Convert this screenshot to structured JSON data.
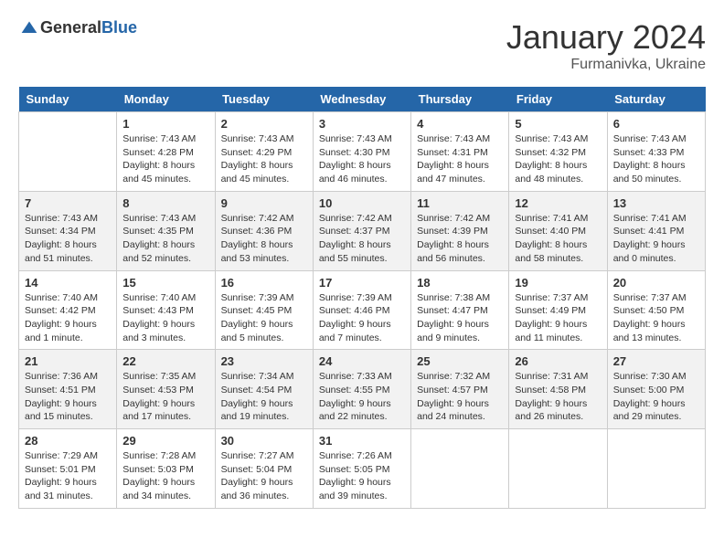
{
  "header": {
    "logo_general": "General",
    "logo_blue": "Blue",
    "month": "January 2024",
    "location": "Furmanivka, Ukraine"
  },
  "weekdays": [
    "Sunday",
    "Monday",
    "Tuesday",
    "Wednesday",
    "Thursday",
    "Friday",
    "Saturday"
  ],
  "weeks": [
    [
      {
        "day": "",
        "sunrise": "",
        "sunset": "",
        "daylight": ""
      },
      {
        "day": "1",
        "sunrise": "Sunrise: 7:43 AM",
        "sunset": "Sunset: 4:28 PM",
        "daylight": "Daylight: 8 hours and 45 minutes."
      },
      {
        "day": "2",
        "sunrise": "Sunrise: 7:43 AM",
        "sunset": "Sunset: 4:29 PM",
        "daylight": "Daylight: 8 hours and 45 minutes."
      },
      {
        "day": "3",
        "sunrise": "Sunrise: 7:43 AM",
        "sunset": "Sunset: 4:30 PM",
        "daylight": "Daylight: 8 hours and 46 minutes."
      },
      {
        "day": "4",
        "sunrise": "Sunrise: 7:43 AM",
        "sunset": "Sunset: 4:31 PM",
        "daylight": "Daylight: 8 hours and 47 minutes."
      },
      {
        "day": "5",
        "sunrise": "Sunrise: 7:43 AM",
        "sunset": "Sunset: 4:32 PM",
        "daylight": "Daylight: 8 hours and 48 minutes."
      },
      {
        "day": "6",
        "sunrise": "Sunrise: 7:43 AM",
        "sunset": "Sunset: 4:33 PM",
        "daylight": "Daylight: 8 hours and 50 minutes."
      }
    ],
    [
      {
        "day": "7",
        "sunrise": "Sunrise: 7:43 AM",
        "sunset": "Sunset: 4:34 PM",
        "daylight": "Daylight: 8 hours and 51 minutes."
      },
      {
        "day": "8",
        "sunrise": "Sunrise: 7:43 AM",
        "sunset": "Sunset: 4:35 PM",
        "daylight": "Daylight: 8 hours and 52 minutes."
      },
      {
        "day": "9",
        "sunrise": "Sunrise: 7:42 AM",
        "sunset": "Sunset: 4:36 PM",
        "daylight": "Daylight: 8 hours and 53 minutes."
      },
      {
        "day": "10",
        "sunrise": "Sunrise: 7:42 AM",
        "sunset": "Sunset: 4:37 PM",
        "daylight": "Daylight: 8 hours and 55 minutes."
      },
      {
        "day": "11",
        "sunrise": "Sunrise: 7:42 AM",
        "sunset": "Sunset: 4:39 PM",
        "daylight": "Daylight: 8 hours and 56 minutes."
      },
      {
        "day": "12",
        "sunrise": "Sunrise: 7:41 AM",
        "sunset": "Sunset: 4:40 PM",
        "daylight": "Daylight: 8 hours and 58 minutes."
      },
      {
        "day": "13",
        "sunrise": "Sunrise: 7:41 AM",
        "sunset": "Sunset: 4:41 PM",
        "daylight": "Daylight: 9 hours and 0 minutes."
      }
    ],
    [
      {
        "day": "14",
        "sunrise": "Sunrise: 7:40 AM",
        "sunset": "Sunset: 4:42 PM",
        "daylight": "Daylight: 9 hours and 1 minute."
      },
      {
        "day": "15",
        "sunrise": "Sunrise: 7:40 AM",
        "sunset": "Sunset: 4:43 PM",
        "daylight": "Daylight: 9 hours and 3 minutes."
      },
      {
        "day": "16",
        "sunrise": "Sunrise: 7:39 AM",
        "sunset": "Sunset: 4:45 PM",
        "daylight": "Daylight: 9 hours and 5 minutes."
      },
      {
        "day": "17",
        "sunrise": "Sunrise: 7:39 AM",
        "sunset": "Sunset: 4:46 PM",
        "daylight": "Daylight: 9 hours and 7 minutes."
      },
      {
        "day": "18",
        "sunrise": "Sunrise: 7:38 AM",
        "sunset": "Sunset: 4:47 PM",
        "daylight": "Daylight: 9 hours and 9 minutes."
      },
      {
        "day": "19",
        "sunrise": "Sunrise: 7:37 AM",
        "sunset": "Sunset: 4:49 PM",
        "daylight": "Daylight: 9 hours and 11 minutes."
      },
      {
        "day": "20",
        "sunrise": "Sunrise: 7:37 AM",
        "sunset": "Sunset: 4:50 PM",
        "daylight": "Daylight: 9 hours and 13 minutes."
      }
    ],
    [
      {
        "day": "21",
        "sunrise": "Sunrise: 7:36 AM",
        "sunset": "Sunset: 4:51 PM",
        "daylight": "Daylight: 9 hours and 15 minutes."
      },
      {
        "day": "22",
        "sunrise": "Sunrise: 7:35 AM",
        "sunset": "Sunset: 4:53 PM",
        "daylight": "Daylight: 9 hours and 17 minutes."
      },
      {
        "day": "23",
        "sunrise": "Sunrise: 7:34 AM",
        "sunset": "Sunset: 4:54 PM",
        "daylight": "Daylight: 9 hours and 19 minutes."
      },
      {
        "day": "24",
        "sunrise": "Sunrise: 7:33 AM",
        "sunset": "Sunset: 4:55 PM",
        "daylight": "Daylight: 9 hours and 22 minutes."
      },
      {
        "day": "25",
        "sunrise": "Sunrise: 7:32 AM",
        "sunset": "Sunset: 4:57 PM",
        "daylight": "Daylight: 9 hours and 24 minutes."
      },
      {
        "day": "26",
        "sunrise": "Sunrise: 7:31 AM",
        "sunset": "Sunset: 4:58 PM",
        "daylight": "Daylight: 9 hours and 26 minutes."
      },
      {
        "day": "27",
        "sunrise": "Sunrise: 7:30 AM",
        "sunset": "Sunset: 5:00 PM",
        "daylight": "Daylight: 9 hours and 29 minutes."
      }
    ],
    [
      {
        "day": "28",
        "sunrise": "Sunrise: 7:29 AM",
        "sunset": "Sunset: 5:01 PM",
        "daylight": "Daylight: 9 hours and 31 minutes."
      },
      {
        "day": "29",
        "sunrise": "Sunrise: 7:28 AM",
        "sunset": "Sunset: 5:03 PM",
        "daylight": "Daylight: 9 hours and 34 minutes."
      },
      {
        "day": "30",
        "sunrise": "Sunrise: 7:27 AM",
        "sunset": "Sunset: 5:04 PM",
        "daylight": "Daylight: 9 hours and 36 minutes."
      },
      {
        "day": "31",
        "sunrise": "Sunrise: 7:26 AM",
        "sunset": "Sunset: 5:05 PM",
        "daylight": "Daylight: 9 hours and 39 minutes."
      },
      {
        "day": "",
        "sunrise": "",
        "sunset": "",
        "daylight": ""
      },
      {
        "day": "",
        "sunrise": "",
        "sunset": "",
        "daylight": ""
      },
      {
        "day": "",
        "sunrise": "",
        "sunset": "",
        "daylight": ""
      }
    ]
  ]
}
